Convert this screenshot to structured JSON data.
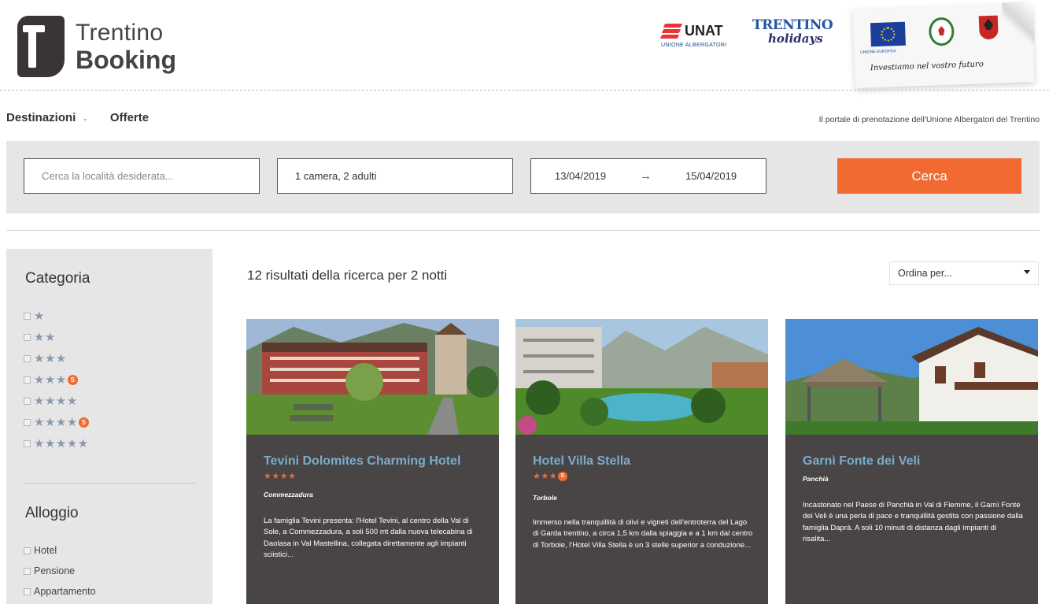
{
  "brand": {
    "line1": "Trentino",
    "line2": "Booking"
  },
  "partners": {
    "unat_name": "UNAT",
    "unat_sub": "UNIONE ALBERGATORI",
    "trentino_top": "TRENTINO",
    "trentino_script": "holidays",
    "eu_motto": "Investiamo nel vostro futuro",
    "eu_caption": "UNIONE EUROPEA"
  },
  "nav": {
    "items": [
      {
        "label": "Destinazioni",
        "has_dropdown": true
      },
      {
        "label": "Offerte"
      }
    ],
    "portal_text": "Il portale di prenotazione dell'Unione Albergatori del Trentino"
  },
  "search": {
    "location_placeholder": "Cerca la località desiderata...",
    "guests": "1 camera, 2 adulti",
    "checkin": "13/04/2019",
    "arrow": "→",
    "checkout": "15/04/2019",
    "button": "Cerca"
  },
  "sidebar": {
    "category_title": "Categoria",
    "categories": [
      {
        "stars": "★",
        "superior": ""
      },
      {
        "stars": "★★",
        "superior": ""
      },
      {
        "stars": "★★★",
        "superior": ""
      },
      {
        "stars": "★★★",
        "superior": "S"
      },
      {
        "stars": "★★★★",
        "superior": ""
      },
      {
        "stars": "★★★★",
        "superior": "S"
      },
      {
        "stars": "★★★★★",
        "superior": ""
      }
    ],
    "accommodation_title": "Alloggio",
    "types": [
      "Hotel",
      "Pensione",
      "Appartamento"
    ]
  },
  "results": {
    "title": "12 risultati della ricerca per 2 notti",
    "sort_label": "Ordina per...",
    "cards": [
      {
        "name": "Tevini Dolomites Charming Hotel",
        "stars": "★★★★",
        "superior": "",
        "location": "Commezzadura",
        "description": "La famiglia Tevini presenta: l'Hotel Tevini, al centro della Val di Sole, a Commezzadura, a soli 500 mt dalla nuova telecabina di Daolasa in Val Mastellina, collegata direttamente agli impianti sciistici..."
      },
      {
        "name": "Hotel Villa Stella",
        "stars": "★★★",
        "superior": "S",
        "location": "Torbole",
        "description": "Immerso nella tranquillità di olivi e vigneti dell'entroterra del Lago di Garda trentino, a circa 1,5 km dalla spiaggia e a 1 km dal centro di Torbole, l'Hotel Villa Stella è un 3 stelle superior a conduzione..."
      },
      {
        "name": "Garnì Fonte dei Veli",
        "stars": "",
        "superior": "",
        "location": "Panchià",
        "description": "Incastonato nel Paese di Panchià in Val di Fiemme, il Garnì Fonte dei Veli è una perla di pace e tranquillità gestita con passione dalla famiglia Daprà. A soli 10 minuti di distanza dagli impianti di risalita..."
      }
    ]
  },
  "colors": {
    "accent": "#f06a32",
    "card_bg": "#4a4545",
    "card_title": "#7aaccc",
    "panel_bg": "#e6e6e6"
  }
}
